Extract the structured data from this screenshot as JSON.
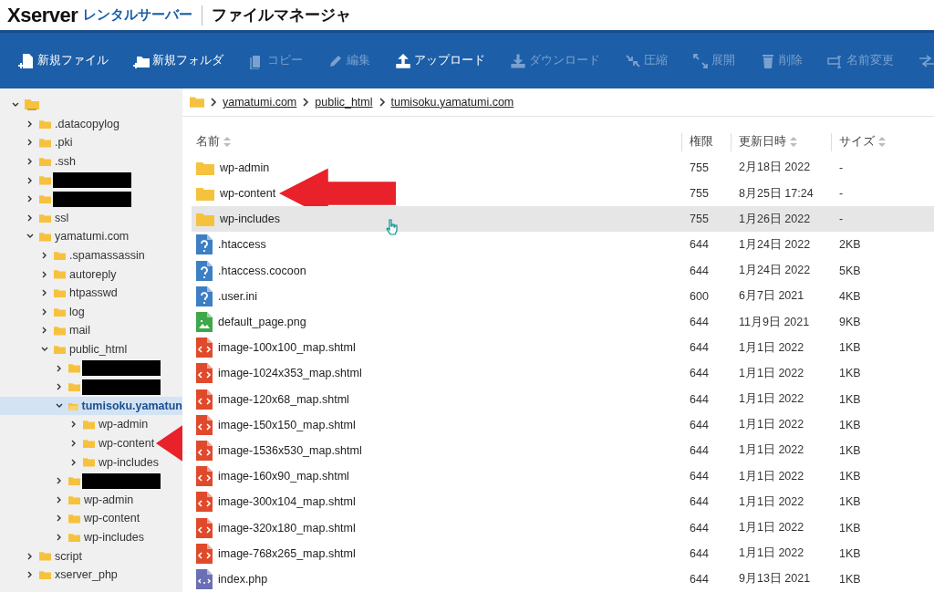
{
  "header": {
    "brand": "Xserver",
    "product": "レンタルサーバー",
    "title": "ファイルマネージャ"
  },
  "toolbar": [
    {
      "label": "新規ファイル",
      "disabled": false
    },
    {
      "label": "新規フォルダ",
      "disabled": false
    },
    {
      "label": "コピー",
      "disabled": true
    },
    {
      "label": "編集",
      "disabled": true
    },
    {
      "label": "アップロード",
      "disabled": false
    },
    {
      "label": "ダウンロード",
      "disabled": true
    },
    {
      "label": "圧縮",
      "disabled": true
    },
    {
      "label": "展開",
      "disabled": true
    },
    {
      "label": "削除",
      "disabled": true
    },
    {
      "label": "名前変更",
      "disabled": true
    },
    {
      "disabled": true
    }
  ],
  "tree": {
    "kind": "root",
    "expanded": true,
    "children": [
      {
        "kind": "folder",
        "label": ".datacopylog",
        "expanded": false,
        "selected": false
      },
      {
        "kind": "folder",
        "label": ".pki",
        "expanded": false,
        "selected": false
      },
      {
        "kind": "folder",
        "label": ".ssh",
        "expanded": false,
        "selected": false
      },
      {
        "kind": "redacted",
        "expanded": false,
        "selected": false
      },
      {
        "kind": "redacted",
        "expanded": false,
        "selected": false
      },
      {
        "kind": "folder",
        "label": "ssl",
        "expanded": false,
        "selected": false
      },
      {
        "kind": "folder",
        "label": "yamatumi.com",
        "expanded": true,
        "selected": false,
        "children": [
          {
            "kind": "folder",
            "label": ".spamassassin",
            "expanded": false,
            "selected": false
          },
          {
            "kind": "folder",
            "label": "autoreply",
            "expanded": false,
            "selected": false
          },
          {
            "kind": "folder",
            "label": "htpasswd",
            "expanded": false,
            "selected": false
          },
          {
            "kind": "folder",
            "label": "log",
            "expanded": false,
            "selected": false
          },
          {
            "kind": "folder",
            "label": "mail",
            "expanded": false,
            "selected": false
          },
          {
            "kind": "folder",
            "label": "public_html",
            "expanded": true,
            "selected": false,
            "children": [
              {
                "kind": "redacted",
                "expanded": false,
                "selected": false
              },
              {
                "kind": "redacted",
                "expanded": false,
                "selected": false
              },
              {
                "kind": "folder",
                "label": "tumisoku.yamatun",
                "expanded": true,
                "selected": true,
                "children": [
                  {
                    "kind": "folder",
                    "label": "wp-admin",
                    "expanded": false,
                    "selected": false
                  },
                  {
                    "kind": "folder",
                    "label": "wp-content",
                    "expanded": false,
                    "selected": false,
                    "arrow": true
                  },
                  {
                    "kind": "folder",
                    "label": "wp-includes",
                    "expanded": false,
                    "selected": false
                  }
                ]
              },
              {
                "kind": "redacted",
                "expanded": false,
                "selected": false
              },
              {
                "kind": "folder",
                "label": "wp-admin",
                "expanded": false,
                "selected": false
              },
              {
                "kind": "folder",
                "label": "wp-content",
                "expanded": false,
                "selected": false
              },
              {
                "kind": "folder",
                "label": "wp-includes",
                "expanded": false,
                "selected": false
              }
            ]
          }
        ]
      },
      {
        "kind": "folder",
        "label": "script",
        "expanded": false,
        "selected": false
      },
      {
        "kind": "folder",
        "label": "xserver_php",
        "expanded": false,
        "selected": false
      }
    ]
  },
  "breadcrumb": [
    "yamatumi.com",
    "public_html",
    "tumisoku.yamatumi.com"
  ],
  "table": {
    "columns": [
      {
        "label": "名前",
        "sortable": true
      },
      {
        "label": "権限",
        "sortable": false
      },
      {
        "label": "更新日時",
        "sortable": true
      },
      {
        "label": "サイズ",
        "sortable": true
      }
    ],
    "rows": [
      {
        "kind": "folder",
        "name": "wp-admin",
        "perm": "755",
        "date": "2月18日 2022",
        "size": "-",
        "highlighted": false
      },
      {
        "kind": "folder",
        "name": "wp-content",
        "perm": "755",
        "date": "8月25日 17:24",
        "size": "-",
        "highlighted": false,
        "arrow": true
      },
      {
        "kind": "folder",
        "name": "wp-includes",
        "perm": "755",
        "date": "1月26日 2022",
        "size": "-",
        "highlighted": true
      },
      {
        "kind": "unknown",
        "name": ".htaccess",
        "perm": "644",
        "date": "1月24日 2022",
        "size": "2KB",
        "highlighted": false
      },
      {
        "kind": "unknown",
        "name": ".htaccess.cocoon",
        "perm": "644",
        "date": "1月24日 2022",
        "size": "5KB",
        "highlighted": false
      },
      {
        "kind": "unknown",
        "name": ".user.ini",
        "perm": "600",
        "date": "6月7日 2021",
        "size": "4KB",
        "highlighted": false
      },
      {
        "kind": "image",
        "name": "default_page.png",
        "perm": "644",
        "date": "11月9日 2021",
        "size": "9KB",
        "highlighted": false
      },
      {
        "kind": "html",
        "name": "image-100x100_map.shtml",
        "perm": "644",
        "date": "1月1日 2022",
        "size": "1KB",
        "highlighted": false
      },
      {
        "kind": "html",
        "name": "image-1024x353_map.shtml",
        "perm": "644",
        "date": "1月1日 2022",
        "size": "1KB",
        "highlighted": false
      },
      {
        "kind": "html",
        "name": "image-120x68_map.shtml",
        "perm": "644",
        "date": "1月1日 2022",
        "size": "1KB",
        "highlighted": false
      },
      {
        "kind": "html",
        "name": "image-150x150_map.shtml",
        "perm": "644",
        "date": "1月1日 2022",
        "size": "1KB",
        "highlighted": false
      },
      {
        "kind": "html",
        "name": "image-1536x530_map.shtml",
        "perm": "644",
        "date": "1月1日 2022",
        "size": "1KB",
        "highlighted": false
      },
      {
        "kind": "html",
        "name": "image-160x90_map.shtml",
        "perm": "644",
        "date": "1月1日 2022",
        "size": "1KB",
        "highlighted": false
      },
      {
        "kind": "html",
        "name": "image-300x104_map.shtml",
        "perm": "644",
        "date": "1月1日 2022",
        "size": "1KB",
        "highlighted": false
      },
      {
        "kind": "html",
        "name": "image-320x180_map.shtml",
        "perm": "644",
        "date": "1月1日 2022",
        "size": "1KB",
        "highlighted": false
      },
      {
        "kind": "html",
        "name": "image-768x265_map.shtml",
        "perm": "644",
        "date": "1月1日 2022",
        "size": "1KB",
        "highlighted": false
      },
      {
        "kind": "php",
        "name": "index.php",
        "perm": "644",
        "date": "9月13日 2021",
        "size": "1KB",
        "highlighted": false
      }
    ]
  }
}
